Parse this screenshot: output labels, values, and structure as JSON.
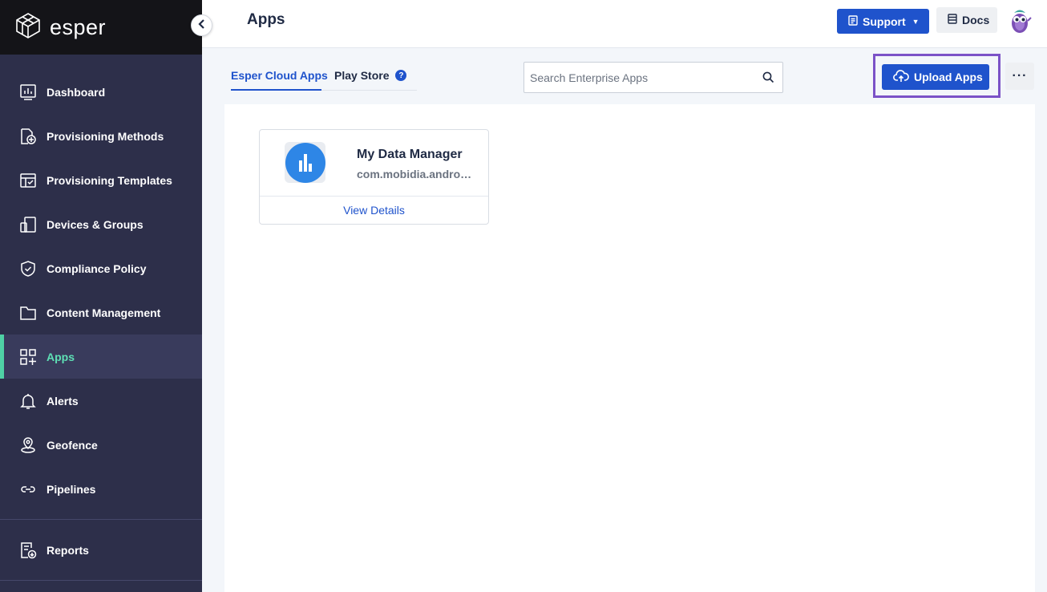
{
  "brand": {
    "name": "esper"
  },
  "sidebar": {
    "items": [
      {
        "label": "Dashboard",
        "icon": "dashboard-icon"
      },
      {
        "label": "Provisioning Methods",
        "icon": "provisioning-methods-icon"
      },
      {
        "label": "Provisioning Templates",
        "icon": "provisioning-templates-icon"
      },
      {
        "label": "Devices & Groups",
        "icon": "devices-icon"
      },
      {
        "label": "Compliance Policy",
        "icon": "shield-icon"
      },
      {
        "label": "Content Management",
        "icon": "folder-icon"
      },
      {
        "label": "Apps",
        "icon": "apps-icon",
        "active": true
      },
      {
        "label": "Alerts",
        "icon": "bell-icon"
      },
      {
        "label": "Geofence",
        "icon": "geofence-icon"
      },
      {
        "label": "Pipelines",
        "icon": "pipelines-icon"
      },
      {
        "label": "Reports",
        "icon": "reports-icon"
      }
    ]
  },
  "header": {
    "title": "Apps",
    "support_label": "Support",
    "docs_label": "Docs"
  },
  "tabs": [
    {
      "label": "Esper Cloud Apps",
      "active": true
    },
    {
      "label": "Play Store",
      "active": false
    }
  ],
  "search": {
    "placeholder": "Search Enterprise Apps",
    "value": ""
  },
  "toolbar": {
    "upload_label": "Upload Apps",
    "more_label": "···"
  },
  "apps": [
    {
      "name": "My Data Manager",
      "package": "com.mobidia.android.mdm",
      "action": "View Details"
    }
  ],
  "colors": {
    "sidebar_bg": "#2d2f4a",
    "brand_bg": "#141418",
    "accent": "#1f53cc",
    "active_nav": "#5ee0b5",
    "highlight_frame": "#7b52c7"
  }
}
